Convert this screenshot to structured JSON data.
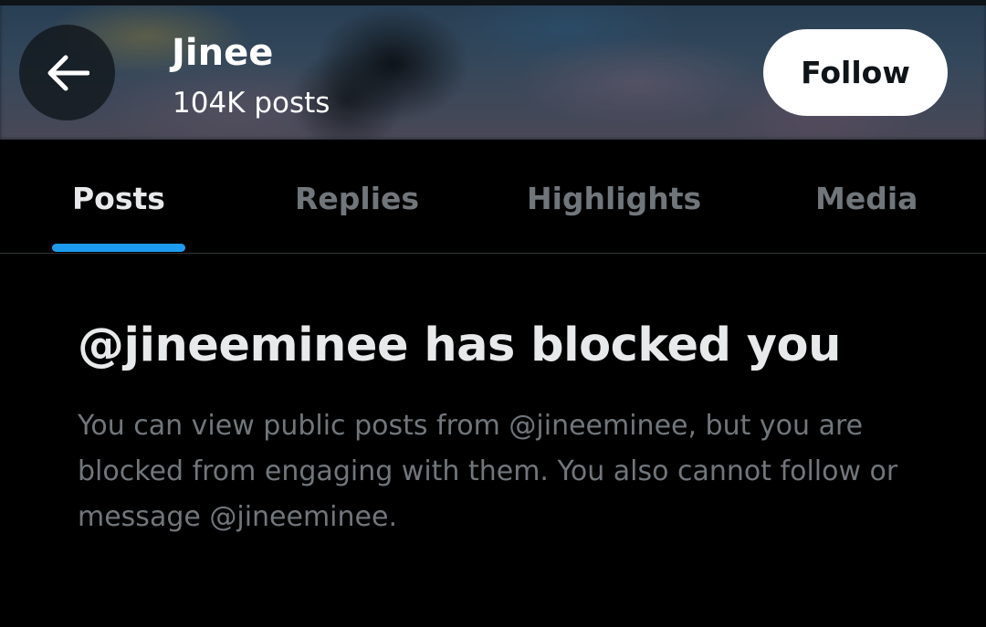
{
  "header": {
    "back_icon": "arrow-left-icon",
    "profile_name": "Jinee",
    "post_count": "104K posts",
    "follow_label": "Follow"
  },
  "tabs": [
    {
      "label": "Posts",
      "active": true
    },
    {
      "label": "Replies",
      "active": false
    },
    {
      "label": "Highlights",
      "active": false
    },
    {
      "label": "Media",
      "active": false
    }
  ],
  "blocked": {
    "title": "@jineeminee has blocked you",
    "body": "You can view public posts from @jineeminee, but you are blocked from engaging with them. You also cannot follow or message @jineeminee."
  },
  "colors": {
    "background": "#000000",
    "primary_text": "#e7e9ea",
    "secondary_text": "#71767b",
    "accent": "#1d9bf0",
    "follow_button_bg": "#ffffff",
    "follow_button_text": "#0f1419",
    "divider": "#2f3336"
  }
}
